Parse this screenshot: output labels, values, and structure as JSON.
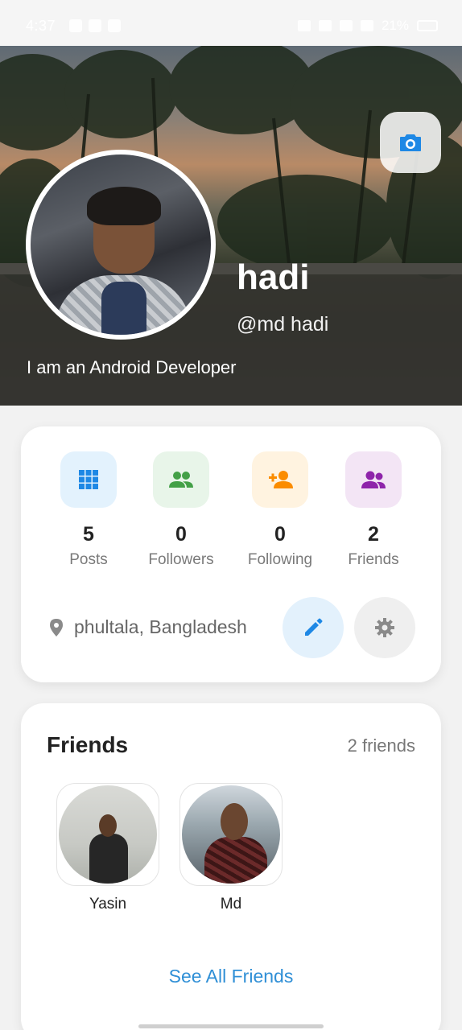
{
  "status_bar": {
    "time": "4:37",
    "battery": "21%"
  },
  "profile": {
    "name": "hadi",
    "handle": "@md hadi",
    "bio": "I am an Android Developer",
    "location": "phultala, Bangladesh"
  },
  "stats": [
    {
      "value": "5",
      "label": "Posts",
      "icon": "grid-icon",
      "color": "#1e88e5",
      "bg": "#e3f2fd"
    },
    {
      "value": "0",
      "label": "Followers",
      "icon": "people-icon",
      "color": "#43a047",
      "bg": "#e8f5e9"
    },
    {
      "value": "0",
      "label": "Following",
      "icon": "person-add-icon",
      "color": "#fb8c00",
      "bg": "#fff3e0"
    },
    {
      "value": "2",
      "label": "Friends",
      "icon": "group-icon",
      "color": "#8e24aa",
      "bg": "#f3e5f5"
    }
  ],
  "friends": {
    "title": "Friends",
    "count": "2 friends",
    "items": [
      {
        "name": "Yasin"
      },
      {
        "name": "Md"
      }
    ],
    "see_all": "See All Friends"
  },
  "colors": {
    "accent": "#2f8fd6"
  }
}
